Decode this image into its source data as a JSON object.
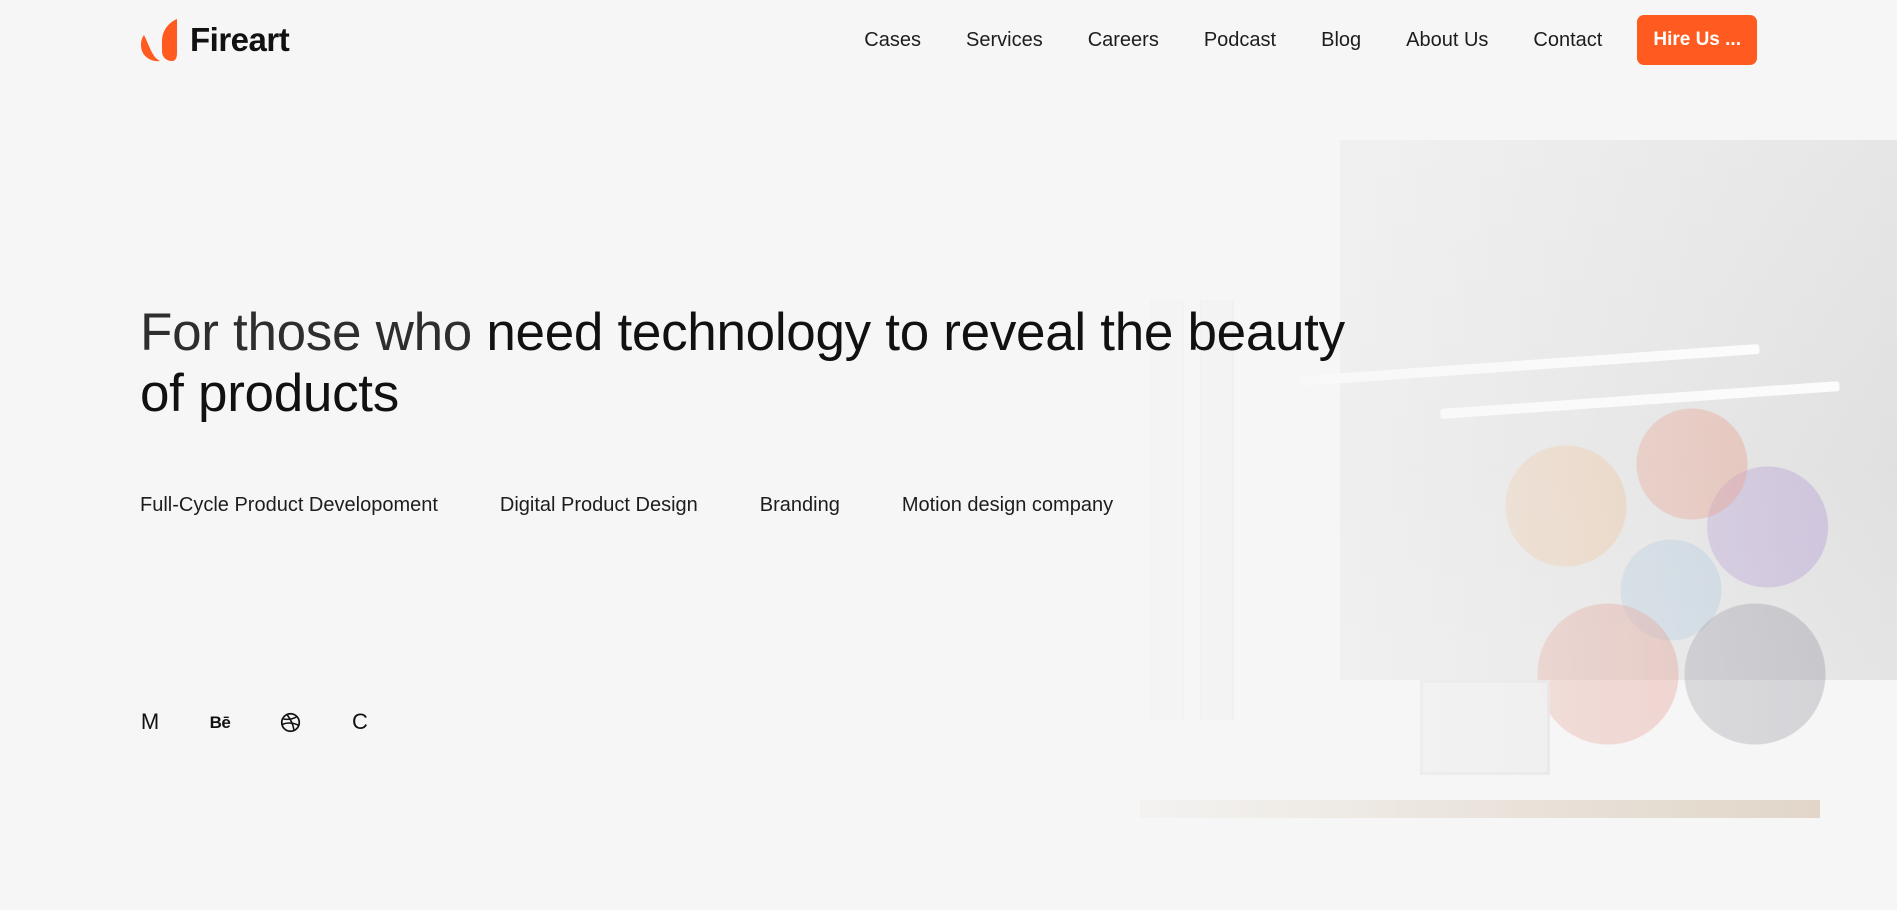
{
  "brand": {
    "name": "Fireart",
    "accent_color": "#ff5a1f",
    "logo_icon": "fireart-flame-icon"
  },
  "nav": {
    "items": [
      {
        "label": "Cases"
      },
      {
        "label": "Services"
      },
      {
        "label": "Careers"
      },
      {
        "label": "Podcast"
      },
      {
        "label": "Blog"
      },
      {
        "label": "About Us"
      },
      {
        "label": "Contact"
      }
    ],
    "cta_label": "Hire Us ..."
  },
  "hero": {
    "title_part1": "For those who ",
    "title_part2": "need technology to reveal the beauty of products"
  },
  "services": [
    "Full-Cycle Product Developoment",
    "Digital Product Design",
    "Branding",
    "Motion design company"
  ],
  "socials": [
    {
      "icon": "medium-icon",
      "glyph": "M"
    },
    {
      "icon": "behance-icon",
      "glyph": "Bē"
    },
    {
      "icon": "dribbble-icon",
      "glyph": ""
    },
    {
      "icon": "clutch-icon",
      "glyph": "C"
    }
  ]
}
